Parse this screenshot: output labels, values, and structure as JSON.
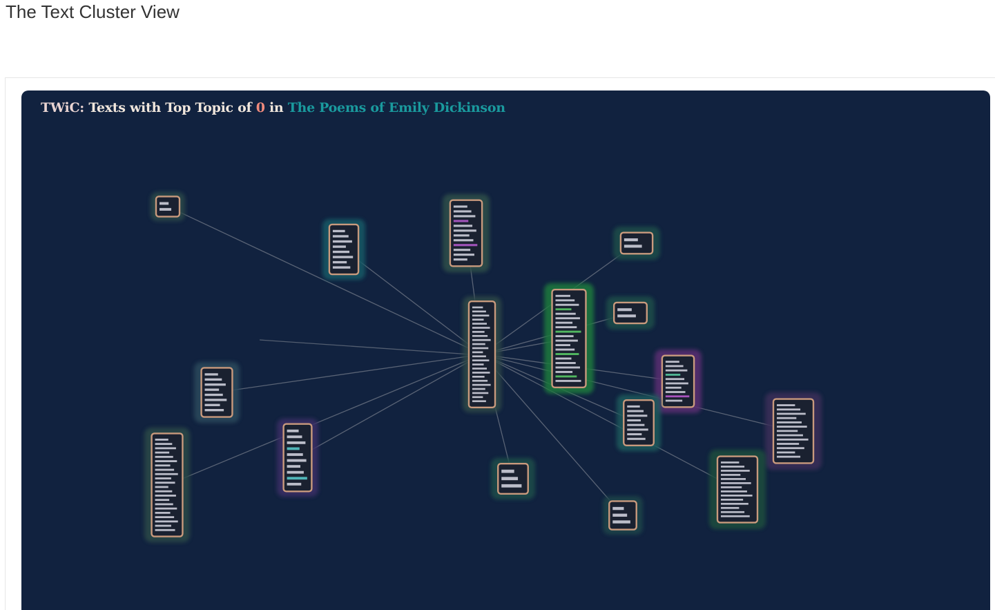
{
  "page": {
    "heading": "The Text Cluster View"
  },
  "panel": {
    "title_app": "TWiC:",
    "title_main": "Texts with Top Topic of",
    "title_topic": "0",
    "title_in": "in",
    "title_corpus": "The Poems of Emily Dickinson",
    "background": "#11223f",
    "colors": {
      "title_app": "#e9d4d2",
      "title_text": "#f0e6dc",
      "topic_number": "#f08a7c",
      "corpus_name": "#1a9a9e",
      "card_border": "#c99a7d",
      "edge": "#8a8f99"
    }
  },
  "cluster": {
    "center": "hub",
    "nodes": [
      {
        "id": "hub",
        "glow": "#2e4a46",
        "lines": 24,
        "accents": []
      },
      {
        "id": "tl-small",
        "glow": "#2c4a48",
        "lines": 2,
        "accents": []
      },
      {
        "id": "top-teal",
        "glow": "#175a66",
        "lines": 8,
        "accents": []
      },
      {
        "id": "top-purple",
        "glow": "#2f4f48",
        "lines": 12,
        "accents": [
          "#b85cd1"
        ]
      },
      {
        "id": "green",
        "glow": "#1f7a3c",
        "lines": 20,
        "accents": [
          "#5cd168"
        ]
      },
      {
        "id": "r-small-a",
        "glow": "#1f4e48",
        "lines": 2,
        "accents": []
      },
      {
        "id": "r-small-b",
        "glow": "#1f4e48",
        "lines": 2,
        "accents": []
      },
      {
        "id": "magenta",
        "glow": "#5a2d72",
        "lines": 10,
        "accents": [
          "#c25ad6",
          "#5ad1a6"
        ]
      },
      {
        "id": "mid-teal",
        "glow": "#1f5a5c",
        "lines": 8,
        "accents": []
      },
      {
        "id": "far-right",
        "glow": "#3b2f58",
        "lines": 13,
        "accents": []
      },
      {
        "id": "bottom-right",
        "glow": "#1f4e3c",
        "lines": 14,
        "accents": []
      },
      {
        "id": "left-mid",
        "glow": "#2a4a5c",
        "lines": 8,
        "accents": []
      },
      {
        "id": "left-purple",
        "glow": "#3a2e66",
        "lines": 10,
        "accents": [
          "#5acfd1"
        ]
      },
      {
        "id": "left-tall",
        "glow": "#2c4a46",
        "lines": 22,
        "accents": []
      },
      {
        "id": "bottom-small",
        "glow": "#1f4e48",
        "lines": 3,
        "accents": []
      },
      {
        "id": "bottom-mid",
        "glow": "#1f4448",
        "lines": 3,
        "accents": []
      }
    ],
    "edges": [
      [
        "hub",
        "tl-small"
      ],
      [
        "hub",
        "top-teal"
      ],
      [
        "hub",
        "top-purple"
      ],
      [
        "hub",
        "green"
      ],
      [
        "hub",
        "r-small-a"
      ],
      [
        "hub",
        "r-small-b"
      ],
      [
        "hub",
        "magenta"
      ],
      [
        "hub",
        "mid-teal"
      ],
      [
        "hub",
        "far-right"
      ],
      [
        "hub",
        "bottom-right"
      ],
      [
        "hub",
        "left-mid"
      ],
      [
        "hub",
        "left-purple"
      ],
      [
        "hub",
        "left-tall"
      ],
      [
        "hub",
        "bottom-small"
      ],
      [
        "hub",
        "bottom-mid"
      ]
    ]
  }
}
